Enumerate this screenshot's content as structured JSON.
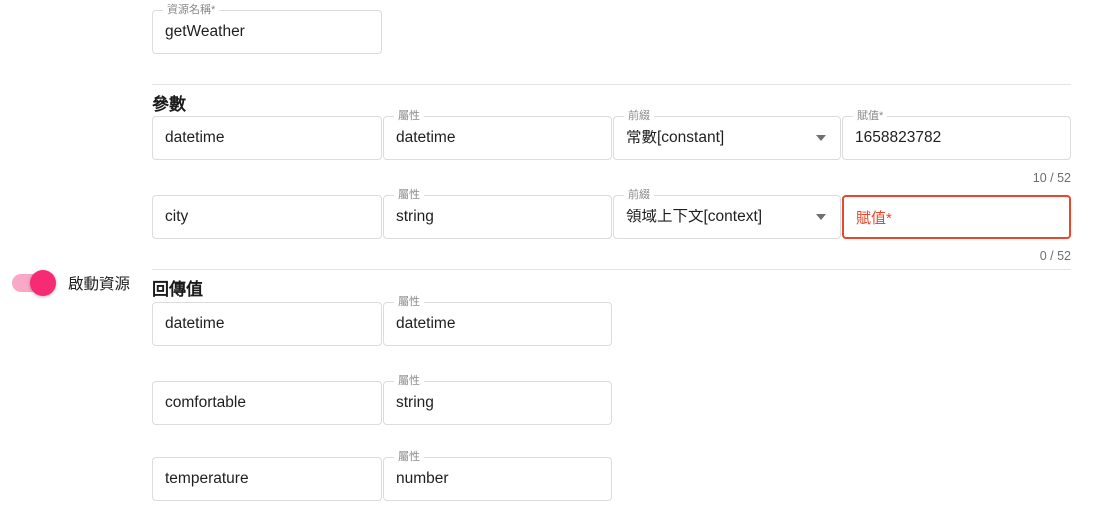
{
  "resource": {
    "name_label": "資源名稱",
    "required_mark": "*",
    "name_value": "getWeather"
  },
  "toggle": {
    "label": "啟動資源",
    "state_on": true,
    "track_color": "#f9a8c6",
    "thumb_color": "#f72a74"
  },
  "parameters": {
    "title": "參數",
    "columns": {
      "name": "",
      "attribute": "屬性",
      "prefix": "前綴",
      "assignment": "賦值"
    },
    "rows": [
      {
        "name": "datetime",
        "attribute": "datetime",
        "prefix": "常數[constant]",
        "assignment": "1658823782",
        "assignment_label": "賦值",
        "counter": "10 / 52",
        "error": false
      },
      {
        "name": "city",
        "attribute": "string",
        "prefix": "領域上下文[context]",
        "assignment": "",
        "assignment_label": "賦值",
        "counter": "0 / 52",
        "error": true,
        "error_color": "#e8472c"
      }
    ]
  },
  "returns": {
    "title": "回傳值",
    "columns": {
      "name": "",
      "attribute": "屬性"
    },
    "rows": [
      {
        "name": "datetime",
        "attribute": "datetime"
      },
      {
        "name": "comfortable",
        "attribute": "string"
      },
      {
        "name": "temperature",
        "attribute": "number"
      }
    ]
  }
}
